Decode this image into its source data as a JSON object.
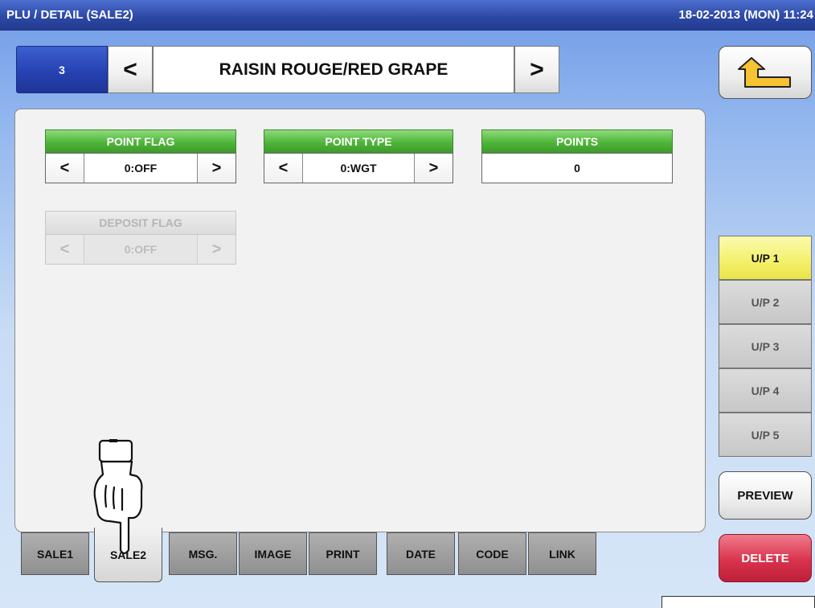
{
  "header": {
    "title": "PLU / DETAIL (SALE2)",
    "datetime": "18-02-2013 (MON) 11:24"
  },
  "plu": {
    "number": "3",
    "name": "RAISIN ROUGE/RED GRAPE",
    "prev_symbol": "<",
    "next_symbol": ">"
  },
  "fields": {
    "point_flag": {
      "label": "POINT FLAG",
      "value": "0:OFF"
    },
    "point_type": {
      "label": "POINT TYPE",
      "value": "0:WGT"
    },
    "points": {
      "label": "POINTS",
      "value": "0"
    },
    "deposit_flag": {
      "label": "DEPOSIT FLAG",
      "value": "0:OFF",
      "enabled": false
    }
  },
  "arrows": {
    "left": "<",
    "right": ">"
  },
  "unit_prices": [
    {
      "label": "U/P 1",
      "active": true
    },
    {
      "label": "U/P 2",
      "active": false
    },
    {
      "label": "U/P 3",
      "active": false
    },
    {
      "label": "U/P 4",
      "active": false
    },
    {
      "label": "U/P 5",
      "active": false
    }
  ],
  "actions": {
    "preview": "PREVIEW",
    "delete": "DELETE"
  },
  "tabs": [
    {
      "label": "SALE1",
      "active": false
    },
    {
      "label": "SALE2",
      "active": true
    },
    {
      "label": "MSG.",
      "active": false
    },
    {
      "label": "IMAGE",
      "active": false
    },
    {
      "label": "PRINT",
      "active": false
    },
    {
      "label": "DATE",
      "active": false
    },
    {
      "label": "CODE",
      "active": false
    },
    {
      "label": "LINK",
      "active": false
    }
  ],
  "colors": {
    "header_blue": "#2d49a6",
    "field_label_green": "#4fb43a",
    "active_up_yellow": "#f3f06a",
    "delete_red": "#d9334d"
  },
  "icons": {
    "back": "return-arrow-icon",
    "pointer": "pointing-hand-icon"
  }
}
